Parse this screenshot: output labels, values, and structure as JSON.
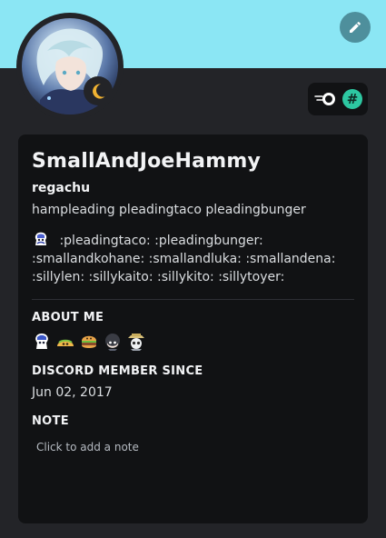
{
  "profile": {
    "display_name": "SmallAndJoeHammy",
    "username": "regachu",
    "pronouns": "hampleading pleadingtaco pleadingbunger",
    "custom_status": ":pleadingtaco: :pleadingbunger: :smallandkohane: :smallandluka: :smallandena: :sillylen: :sillykaito: :sillykito: :sillytoyer:"
  },
  "sections": {
    "about_me_title": "ABOUT ME",
    "member_since_title": "DISCORD MEMBER SINCE",
    "member_since_value": "Jun 02, 2017",
    "note_title": "NOTE",
    "note_placeholder": "Click to add a note"
  },
  "icons": {
    "edit": "pencil-icon",
    "status": "moon-idle-icon",
    "badge_1": "nitro-badge-icon",
    "badge_2": "hash-badge-icon"
  },
  "colors": {
    "banner": "#8be6f4",
    "card_background": "#111214",
    "page_background": "#232428",
    "idle_status": "#f0b232",
    "badge_hash": "#2dc7a1"
  }
}
